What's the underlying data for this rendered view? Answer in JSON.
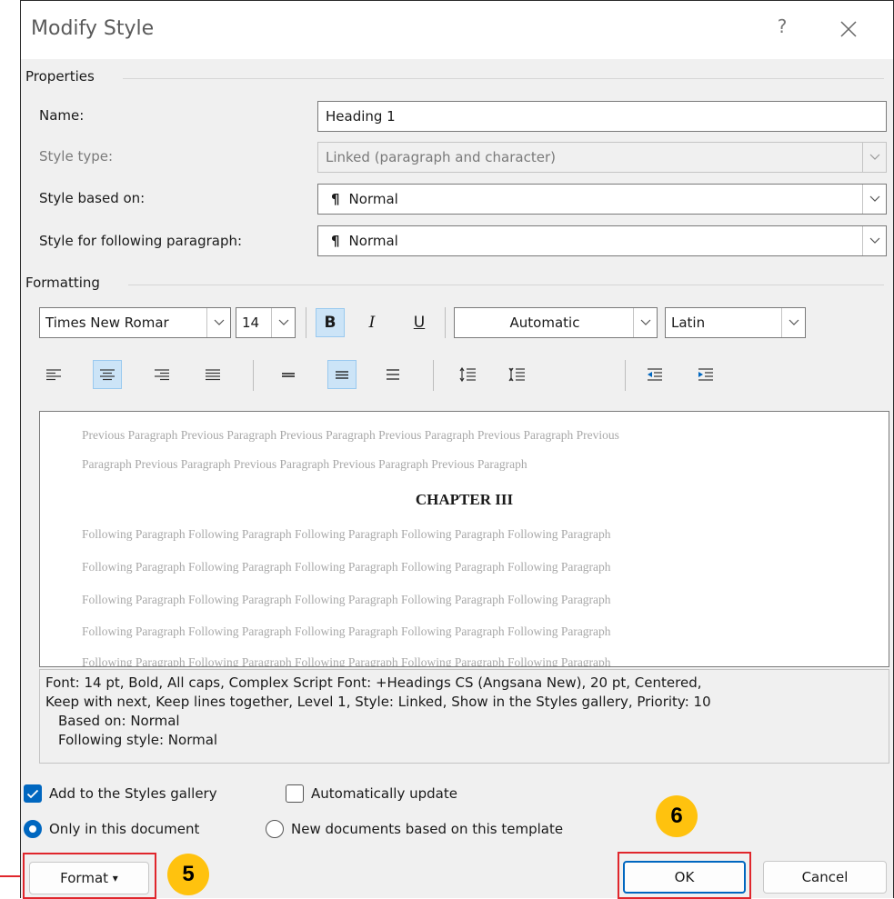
{
  "dialog": {
    "title": "Modify Style",
    "help": "?"
  },
  "properties": {
    "group_label": "Properties",
    "name_label": "Name:",
    "name_value": "Heading 1",
    "style_type_label": "Style type:",
    "style_type_value": "Linked (paragraph and character)",
    "based_on_label": "Style based on:",
    "based_on_value": "Normal",
    "following_label": "Style for following paragraph:",
    "following_value": "Normal",
    "pilcrow": "¶"
  },
  "formatting": {
    "group_label": "Formatting",
    "font": "Times New Romar",
    "size": "14",
    "bold": "B",
    "italic": "I",
    "underline": "U",
    "color": "Automatic",
    "script": "Latin"
  },
  "preview": {
    "previous_line_1": "Previous Paragraph Previous Paragraph Previous Paragraph Previous Paragraph Previous Paragraph Previous",
    "previous_line_2": "Paragraph Previous Paragraph Previous Paragraph Previous Paragraph Previous Paragraph",
    "heading": "CHAPTER III",
    "following_line": "Following Paragraph Following Paragraph Following Paragraph Following Paragraph Following Paragraph"
  },
  "description": {
    "line1": "Font: 14 pt, Bold, All caps, Complex Script Font: +Headings CS (Angsana New), 20 pt, Centered,",
    "line2": "Keep with next, Keep lines together, Level 1, Style: Linked, Show in the Styles gallery, Priority: 10",
    "line3": "Based on: Normal",
    "line4": "Following style: Normal"
  },
  "options": {
    "add_to_gallery": "Add to the Styles gallery",
    "auto_update": "Automatically update",
    "only_this_doc": "Only in this document",
    "new_docs": "New documents based on this template"
  },
  "buttons": {
    "format": "Format",
    "format_arrow": "▾",
    "ok": "OK",
    "cancel": "Cancel"
  },
  "callouts": {
    "step5": "5",
    "step6": "6"
  },
  "colors": {
    "accent": "#0067c0",
    "highlight_box": "#e0262c",
    "callout": "#ffc20e"
  }
}
